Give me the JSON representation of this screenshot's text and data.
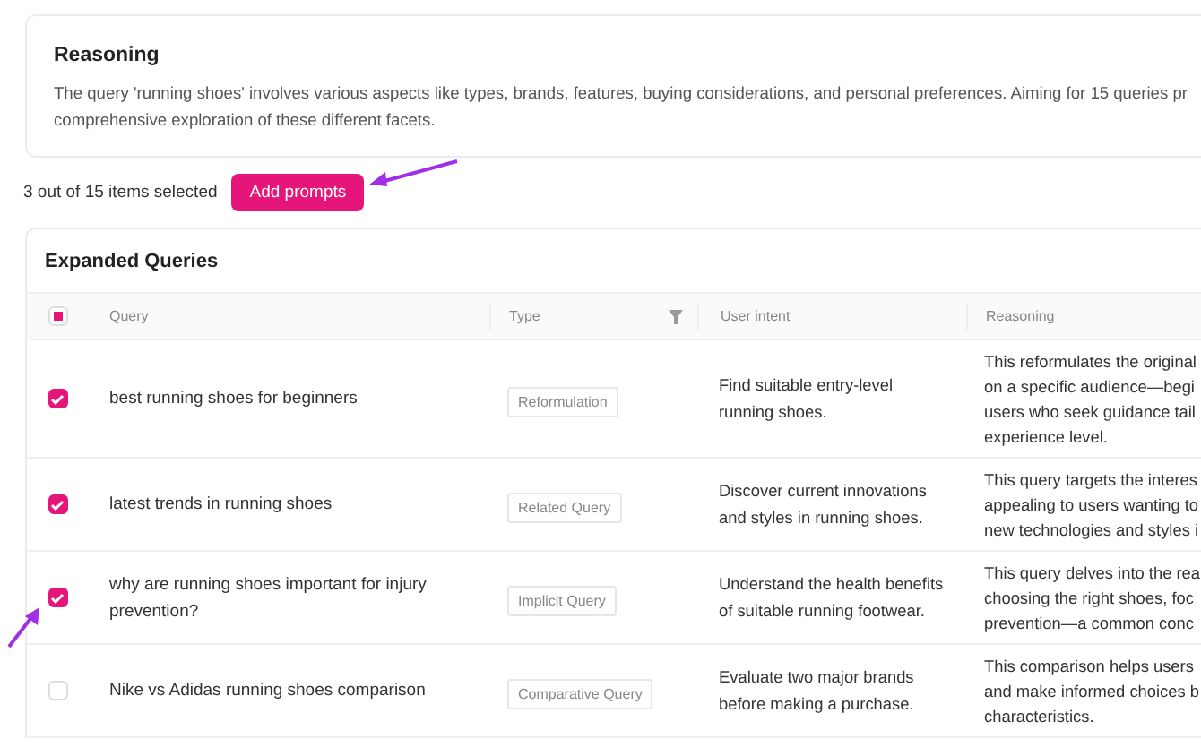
{
  "reasoning_card": {
    "title": "Reasoning",
    "text": "The query 'running shoes' involves various aspects like types, brands, features, buying considerations, and personal preferences. Aiming for 15 queries pr\ncomprehensive exploration of these different facets."
  },
  "selection": {
    "summary": "3 out of 15 items selected",
    "button": "Add prompts"
  },
  "table": {
    "title": "Expanded Queries",
    "select_all": {
      "partial": true
    },
    "columns": [
      "Query",
      "Type",
      "User intent",
      "Reasoning"
    ],
    "rows": [
      {
        "selected": true,
        "query": "best running shoes for beginners",
        "type": "Reformulation",
        "intent": "Find suitable entry-level running shoes.",
        "reasoning": "This reformulates the original\non a specific audience—begi\nusers who seek guidance tail\nexperience level."
      },
      {
        "selected": true,
        "query": "latest trends in running shoes",
        "type": "Related Query",
        "intent": "Discover current innovations and styles in running shoes.",
        "reasoning": "This query targets the interes\nappealing to users wanting to\nnew technologies and styles i"
      },
      {
        "selected": true,
        "query": "why are running shoes important for injury prevention?",
        "type": "Implicit Query",
        "intent": "Understand the health benefits of suitable running footwear.",
        "reasoning": "This query delves into the rea\nchoosing the right shoes, foc\nprevention—a common conc"
      },
      {
        "selected": false,
        "query": "Nike vs Adidas running shoes comparison",
        "type": "Comparative Query",
        "intent": "Evaluate two major brands before making a purchase.",
        "reasoning": "This comparison helps users\nand make informed choices b\ncharacteristics."
      }
    ]
  }
}
